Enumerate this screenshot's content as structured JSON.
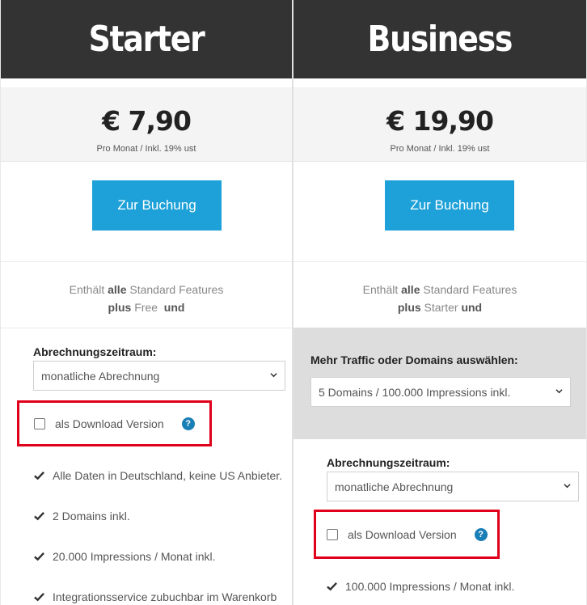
{
  "plans": [
    {
      "name": "Starter",
      "price": "€ 7,90",
      "price_note": "Pro Monat / Inkl. 19% ust",
      "book_label": "Zur Buchung",
      "features_intro": {
        "pre": "Enthält",
        "strong1": "alle",
        "post1": "Standard Features",
        "strong2": "plus",
        "base": "Free",
        "strong3": "und"
      },
      "billing_label": "Abrechnungszeitraum:",
      "billing_value": "monatliche Abrechnung",
      "download_label": "als Download Version",
      "features": [
        "Alle Daten in Deutschland, keine US Anbieter.",
        "2 Domains inkl.",
        "20.000  Impressions / Monat inkl.",
        "Integrationsservice zubuchbar im Warenkorb"
      ]
    },
    {
      "name": "Business",
      "price": "€ 19,90",
      "price_note": "Pro Monat / Inkl. 19% ust",
      "book_label": "Zur Buchung",
      "features_intro": {
        "pre": "Enthält",
        "strong1": "alle",
        "post1": "Standard Features",
        "strong2": "plus",
        "base": "Starter",
        "strong3": "und"
      },
      "traffic_label": "Mehr Traffic oder Domains auswählen:",
      "traffic_value": "5 Domains / 100.000 Impressions inkl.",
      "billing_label": "Abrechnungszeitraum:",
      "billing_value": "monatliche Abrechnung",
      "download_label": "als Download Version",
      "features": [
        "100.000 Impressions / Monat inkl."
      ]
    }
  ],
  "icons": {
    "help": "question-circle-icon",
    "check": "check-icon",
    "dropdown": "chevron-down-icon"
  },
  "colors": {
    "header_bg": "#333333",
    "button_bg": "#1ea1d8",
    "highlight": "#e0001b",
    "help_icon": "#1a7fb6"
  },
  "help_glyph": "?"
}
